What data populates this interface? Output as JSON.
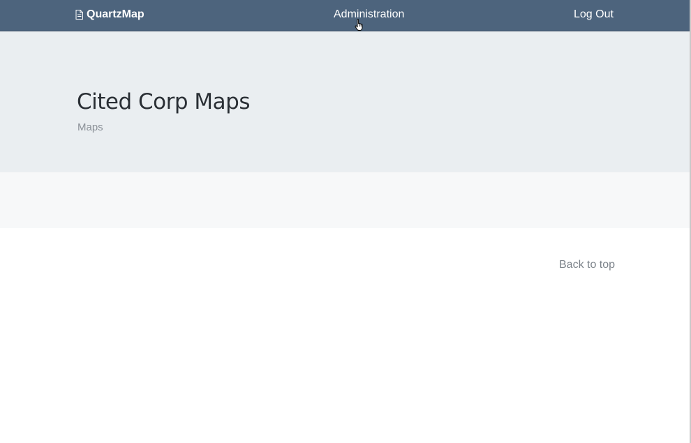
{
  "navbar": {
    "brand": "QuartzMap",
    "brand_icon": "document-icon",
    "links": [
      {
        "label": "Administration"
      },
      {
        "label": "Log Out"
      }
    ],
    "background": "#4d647d"
  },
  "header": {
    "title": "Cited Corp Maps",
    "subtitle": "Maps",
    "background": "#eaeef1"
  },
  "footer": {
    "back_to_top": "Back to top"
  }
}
